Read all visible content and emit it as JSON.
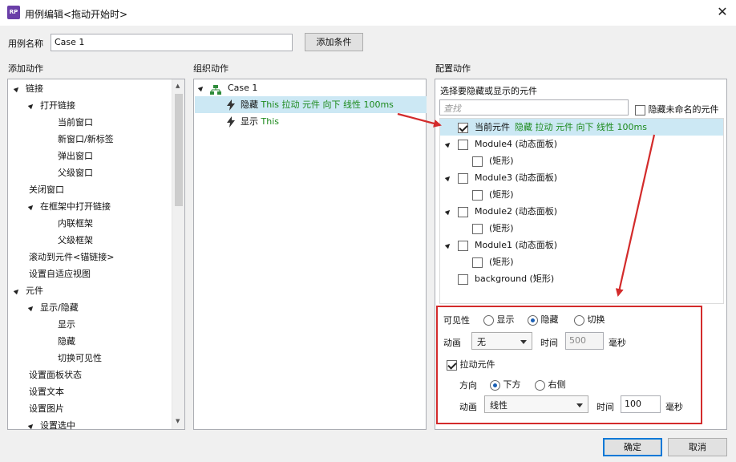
{
  "window": {
    "title": "用例编辑<拖动开始时>",
    "app_icon_text": "RP"
  },
  "case_name": {
    "label": "用例名称",
    "value": "Case 1"
  },
  "add_condition_label": "添加条件",
  "left_panel": {
    "heading": "添加动作",
    "items": [
      {
        "label": "链接",
        "level": 0,
        "expandable": true
      },
      {
        "label": "打开链接",
        "level": 1,
        "expandable": true
      },
      {
        "label": "当前窗口",
        "level": 2
      },
      {
        "label": "新窗口/新标签",
        "level": 2
      },
      {
        "label": "弹出窗口",
        "level": 2
      },
      {
        "label": "父级窗口",
        "level": 2
      },
      {
        "label": "关闭窗口",
        "level": 1
      },
      {
        "label": "在框架中打开链接",
        "level": 1,
        "expandable": true
      },
      {
        "label": "内联框架",
        "level": 2
      },
      {
        "label": "父级框架",
        "level": 2
      },
      {
        "label": "滚动到元件<锚链接>",
        "level": 1
      },
      {
        "label": "设置自适应视图",
        "level": 1
      },
      {
        "label": "元件",
        "level": 0,
        "expandable": true
      },
      {
        "label": "显示/隐藏",
        "level": 1,
        "expandable": true
      },
      {
        "label": "显示",
        "level": 2
      },
      {
        "label": "隐藏",
        "level": 2
      },
      {
        "label": "切换可见性",
        "level": 2
      },
      {
        "label": "设置面板状态",
        "level": 1
      },
      {
        "label": "设置文本",
        "level": 1
      },
      {
        "label": "设置图片",
        "level": 1
      },
      {
        "label": "设置选中",
        "level": 1,
        "expandable": true
      }
    ]
  },
  "middle_panel": {
    "heading": "组织动作",
    "case_label": "Case 1",
    "actions": [
      {
        "verb": "隐藏",
        "detail": "This 拉动 元件 向下 线性 100ms"
      },
      {
        "verb": "显示",
        "detail": "This"
      }
    ]
  },
  "right_panel": {
    "heading": "配置动作",
    "subheading": "选择要隐藏或显示的元件",
    "search_placeholder": "查找",
    "hide_unnamed_label": "隐藏未命名的元件",
    "widgets": [
      {
        "name": "当前元件",
        "detail": "隐藏 拉动 元件 向下 线性 100ms",
        "checked": true,
        "indent": 0,
        "expandable": false,
        "selected": true
      },
      {
        "name": "Module4 (动态面板)",
        "detail": "",
        "checked": false,
        "indent": 0,
        "expandable": true
      },
      {
        "name": "(矩形)",
        "detail": "",
        "checked": false,
        "indent": 1
      },
      {
        "name": "Module3 (动态面板)",
        "detail": "",
        "checked": false,
        "indent": 0,
        "expandable": true
      },
      {
        "name": "(矩形)",
        "detail": "",
        "checked": false,
        "indent": 1
      },
      {
        "name": "Module2 (动态面板)",
        "detail": "",
        "checked": false,
        "indent": 0,
        "expandable": true
      },
      {
        "name": "(矩形)",
        "detail": "",
        "checked": false,
        "indent": 1
      },
      {
        "name": "Module1 (动态面板)",
        "detail": "",
        "checked": false,
        "indent": 0,
        "expandable": true
      },
      {
        "name": "(矩形)",
        "detail": "",
        "checked": false,
        "indent": 1
      },
      {
        "name": "background (矩形)",
        "detail": "",
        "checked": false,
        "indent": 0
      }
    ],
    "config": {
      "visibility_label": "可见性",
      "opt_show": "显示",
      "opt_hide": "隐藏",
      "opt_toggle": "切换",
      "selected_visibility": "隐藏",
      "animation_label": "动画",
      "animation_value": "无",
      "time_label": "时间",
      "time_value": "500",
      "ms_label": "毫秒",
      "drag_label": "拉动元件",
      "drag_checked": true,
      "direction_label": "方向",
      "dir_down": "下方",
      "dir_right": "右侧",
      "selected_direction": "下方",
      "anim2_label": "动画",
      "anim2_value": "线性",
      "time2_label": "时间",
      "time2_value": "100",
      "ms2_label": "毫秒"
    }
  },
  "footer": {
    "ok_label": "确定",
    "cancel_label": "取消"
  },
  "colors": {
    "highlight": "#cce8f4",
    "accent_green": "#1d8a1d",
    "annotation_red": "#d32b2b",
    "primary_border": "#0078d7"
  }
}
